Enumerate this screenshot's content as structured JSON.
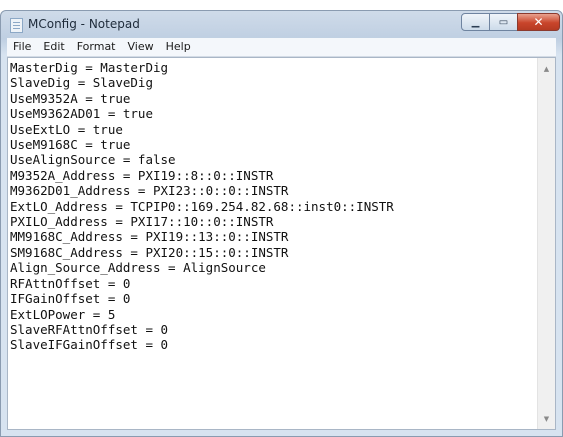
{
  "window": {
    "title": "MConfig - Notepad",
    "icon": "notepad-icon",
    "buttons": {
      "minimize": "minimize-icon",
      "maximize": "maximize-icon",
      "close": "close-icon"
    }
  },
  "menu": [
    "File",
    "Edit",
    "Format",
    "View",
    "Help"
  ],
  "editor": {
    "lines": [
      "MasterDig = MasterDig",
      "SlaveDig = SlaveDig",
      "UseM9352A = true",
      "UseM9362AD01 = true",
      "UseExtLO = true",
      "UseM9168C = true",
      "UseAlignSource = false",
      "M9352A_Address = PXI19::8::0::INSTR",
      "M9362D01_Address = PXI23::0::0::INSTR",
      "ExtLO_Address = TCPIP0::169.254.82.68::inst0::INSTR",
      "PXILO_Address = PXI17::10::0::INSTR",
      "MM9168C_Address = PXI19::13::0::INSTR",
      "SM9168C_Address = PXI20::15::0::INSTR",
      "Align_Source_Address = AlignSource",
      "RFAttnOffset = 0",
      "IFGainOffset = 0",
      "ExtLOPower = 5",
      "SlaveRFAttnOffset = 0",
      "SlaveIFGainOffset = 0"
    ]
  },
  "colors": {
    "titlebar": "#c9d7e8",
    "close_button": "#c9452b"
  }
}
